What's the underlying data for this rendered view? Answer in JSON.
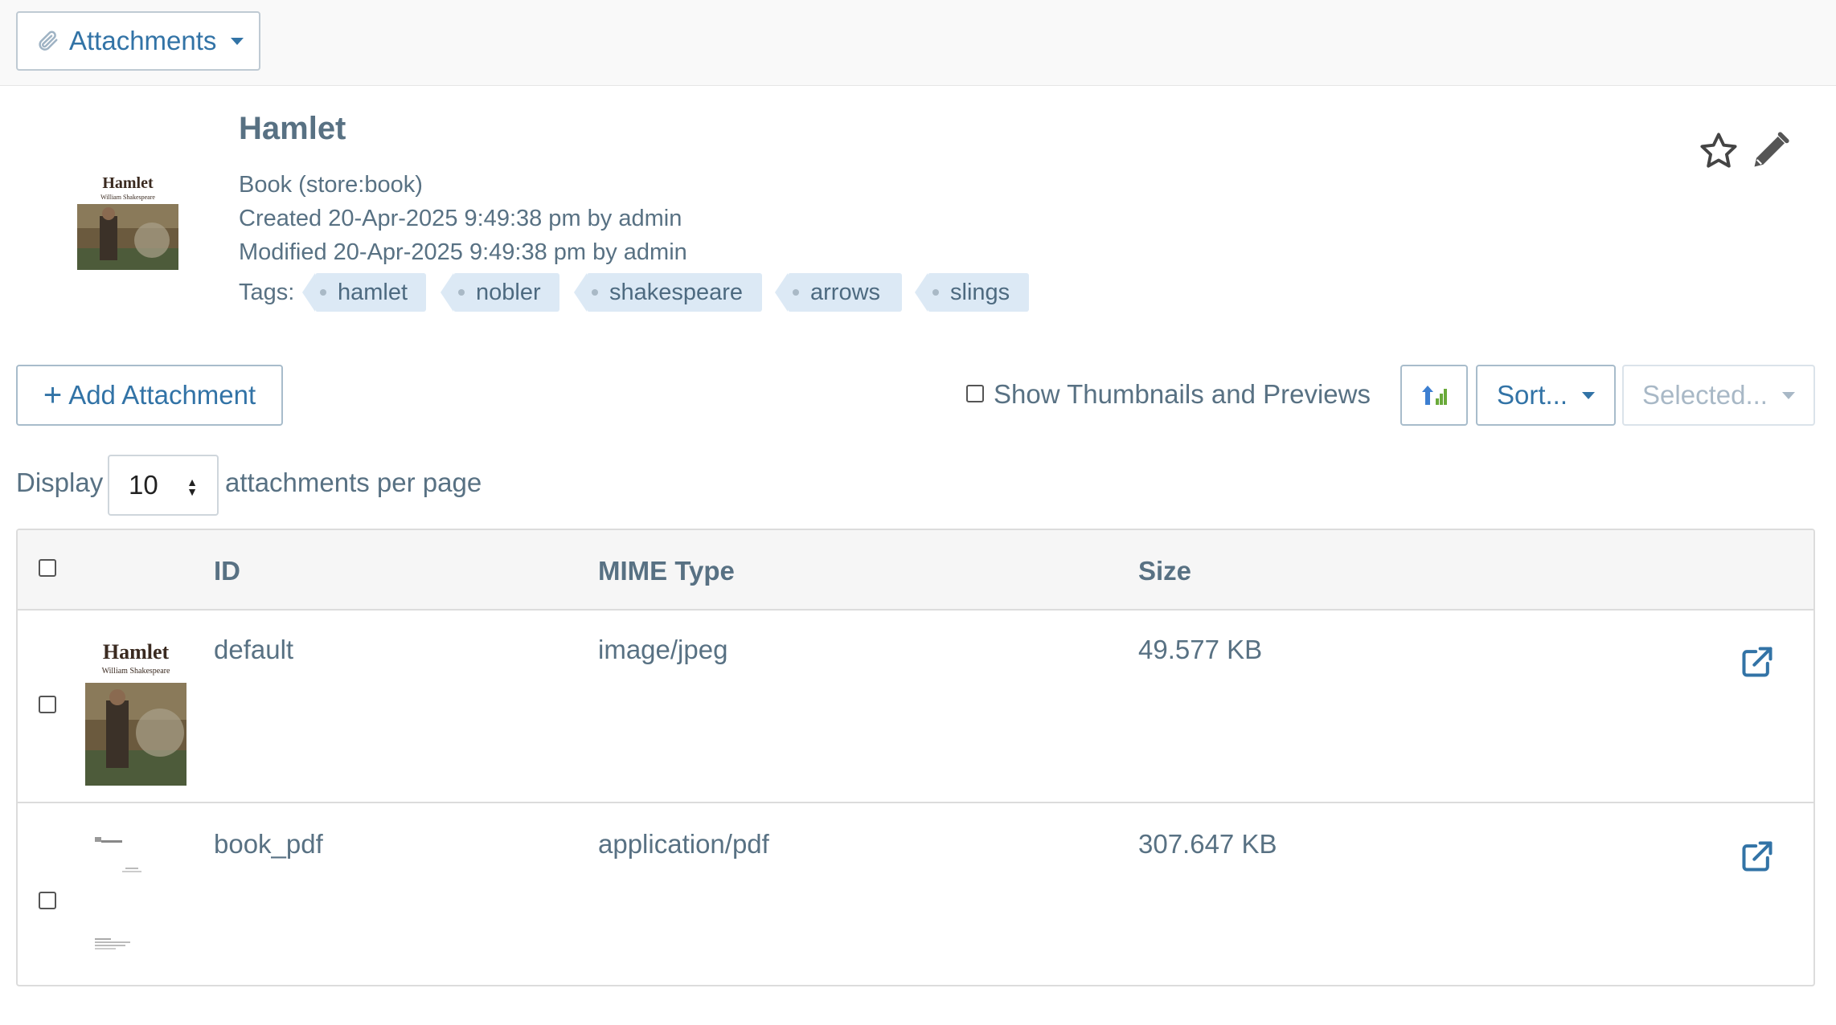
{
  "toolbar": {
    "attachments_label": "Attachments"
  },
  "record": {
    "title": "Hamlet",
    "type_prefix": "Book (",
    "type_link": "store:book",
    "type_suffix": ")",
    "created": "Created 20-Apr-2025 9:49:38 pm by admin",
    "modified": "Modified 20-Apr-2025 9:49:38 pm by admin",
    "tags_label": "Tags:",
    "tags": [
      "hamlet",
      "nobler",
      "shakespeare",
      "arrows",
      "slings"
    ],
    "thumb_title": "Hamlet",
    "thumb_subtitle": "William Shakespeare"
  },
  "controls": {
    "add_label": "Add Attachment",
    "thumbs_label": "Show Thumbnails and Previews",
    "sort_label": "Sort...",
    "selected_label": "Selected...",
    "display_label": "Display",
    "per_page_value": "10",
    "per_page_label": "attachments per page"
  },
  "table": {
    "columns": [
      "ID",
      "MIME Type",
      "Size"
    ],
    "rows": [
      {
        "id": "default",
        "mime": "image/jpeg",
        "size": "49.577 KB"
      },
      {
        "id": "book_pdf",
        "mime": "application/pdf",
        "size": "307.647 KB"
      }
    ]
  },
  "colors": {
    "link": "#3273a6",
    "text": "#587183",
    "tag_bg": "#dce9f5"
  }
}
